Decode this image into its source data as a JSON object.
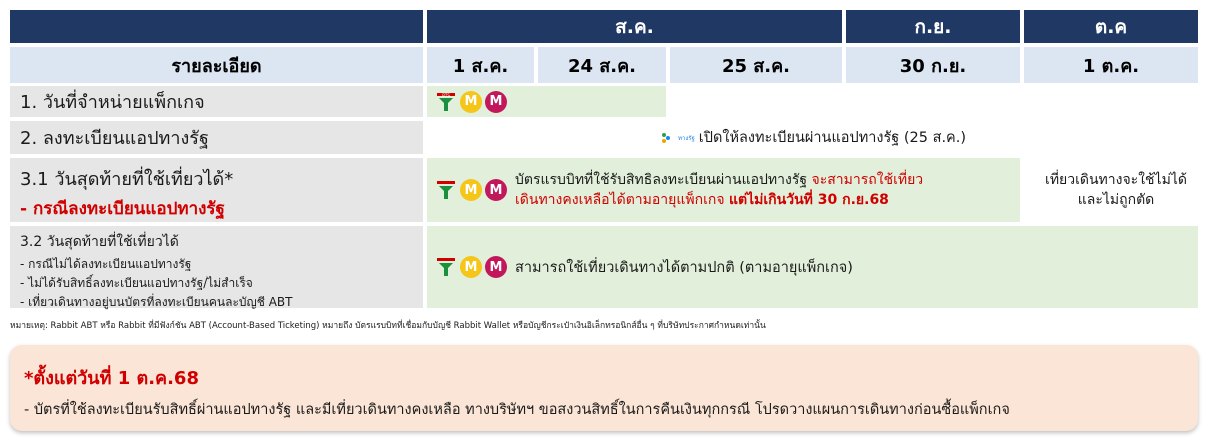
{
  "header": {
    "month_aug": "ส.ค.",
    "month_sep": "ก.ย.",
    "month_oct": "ต.ค"
  },
  "subheader": {
    "detail": "รายละเอียด",
    "d1": "1 ส.ค.",
    "d2": "24 ส.ค.",
    "d3": "25 ส.ค.",
    "d4": "30 ก.ย.",
    "d5": "1 ต.ค."
  },
  "rows": {
    "r1": {
      "label": "1.  วันที่จำหน่ายแพ็กเกจ"
    },
    "r2": {
      "label": "2. ลงทะเบียนแอปทางรัฐ",
      "app_badge": "ทางรัฐ",
      "text": "เปิดให้ลงทะเบียนผ่านแอปทางรัฐ (25 ส.ค.)"
    },
    "r3": {
      "label_line1": "3.1 วันสุดท้ายที่ใช้เที่ยวได้*",
      "label_line2": "- กรณีลงทะเบียนแอปทางรัฐ",
      "text_a": "บัตรแรบบิทที่ใช้รับสิทธิลงทะเบียนผ่านแอปทางรัฐ ",
      "text_b": "จะสามารถใช้เที่ยว",
      "text_c": "เดินทางคงเหลือได้ตามอายุแพ็กเกจ ",
      "text_d": "แต่ไม่เกินวันที่ 30 ก.ย.68",
      "oct_line1": "เที่ยวเดินทางจะใช้ไม่ได้",
      "oct_line2": "และไม่ถูกตัด"
    },
    "r4": {
      "label_line1": "3.2 วันสุดท้ายที่ใช้เที่ยวได้",
      "label_line2": "- กรณีไม่ได้ลงทะเบียนแอปทางรัฐ",
      "label_line3": "- ไม่ได้รับสิทธิ์ลงทะเบียนแอปทางรัฐ/ไม่สำเร็จ",
      "label_line4": "- เที่ยวเดินทางอยู่บนบัตรที่ลงทะเบียนคนละบัญชี ABT",
      "text": "สามารถใช้เที่ยวเดินทางได้ตามปกติ (ตามอายุแพ็กเกจ)"
    }
  },
  "icons": {
    "bts_logo": "BTS",
    "yellow_line": "M",
    "pink_line": "M",
    "bts_icon": "bts-logo-icon",
    "yellow_icon": "yellow-line-icon",
    "pink_icon": "pink-line-icon"
  },
  "footnote": "หมายเหตุ: Rabbit ABT หรือ Rabbit ที่มีฟังก์ชัน ABT (Account-Based Ticketing) หมายถึง บัตรแรบบิทที่เชื่อมกับบัญชี Rabbit Wallet หรือบัญชีกระเป๋าเงินอิเล็กทรอนิกส์อื่น ๆ ที่บริษัทประกาศกำหนดเท่านั้น",
  "notice": {
    "title": "*ตั้งแต่วันที่ 1 ต.ค.68",
    "body": "- บัตรที่ใช้ลงทะเบียนรับสิทธิ์ผ่านแอปทางรัฐ และมีเที่ยวเดินทางคงเหลือ ทางบริษัทฯ ขอสงวนสิทธิ์ในการคืนเงินทุกกรณี โปรดวางแผนการเดินทางก่อนซื้อแพ็กเกจ"
  },
  "colors": {
    "header": "#1f3864",
    "subheader": "#dce6f2",
    "label_bg": "#e6e6e6",
    "green": "#e2efda",
    "red": "#d00000",
    "notice_bg": "#fbe5d6",
    "yellow": "#f5c518",
    "magenta": "#c2185b"
  }
}
